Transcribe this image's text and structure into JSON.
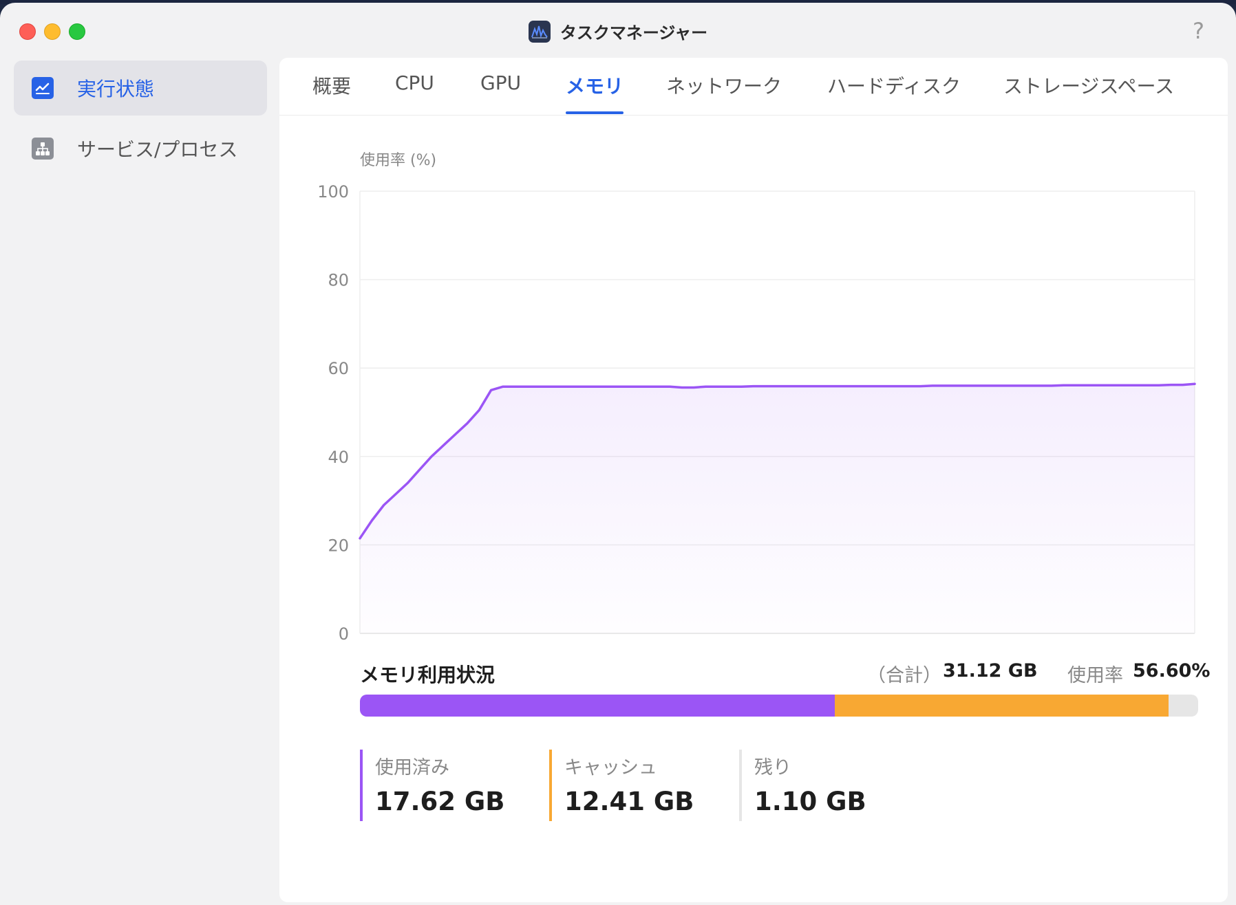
{
  "window": {
    "title": "タスクマネージャー",
    "help": "?"
  },
  "sidebar": {
    "items": [
      {
        "label": "実行状態",
        "icon": "chart-line-icon",
        "active": true
      },
      {
        "label": "サービス/プロセス",
        "icon": "hierarchy-icon",
        "active": false
      }
    ]
  },
  "tabs": [
    {
      "label": "概要",
      "active": false
    },
    {
      "label": "CPU",
      "active": false
    },
    {
      "label": "GPU",
      "active": false
    },
    {
      "label": "メモリ",
      "active": true
    },
    {
      "label": "ネットワーク",
      "active": false
    },
    {
      "label": "ハードディスク",
      "active": false
    },
    {
      "label": "ストレージスペース",
      "active": false
    }
  ],
  "chart_data": {
    "type": "area",
    "title": "",
    "ylabel": "使用率 (%)",
    "xlabel": "",
    "ylim": [
      0,
      100
    ],
    "yticks": [
      100,
      80,
      60,
      40,
      20,
      0
    ],
    "grid": true,
    "color": "#9b55f5",
    "series": [
      {
        "values": [
          21.5,
          25.5,
          29,
          31.5,
          34,
          37,
          40,
          42.5,
          45,
          47.5,
          50.5,
          55,
          55.8,
          55.8,
          55.8,
          55.8,
          55.8,
          55.8,
          55.8,
          55.8,
          55.8,
          55.8,
          55.8,
          55.8,
          55.8,
          55.8,
          55.8,
          55.6,
          55.6,
          55.8,
          55.8,
          55.8,
          55.8,
          55.9,
          55.9,
          55.9,
          55.9,
          55.9,
          55.9,
          55.9,
          55.9,
          55.9,
          55.9,
          55.9,
          55.9,
          55.9,
          55.9,
          55.9,
          56,
          56,
          56,
          56,
          56,
          56,
          56,
          56,
          56,
          56,
          56,
          56.1,
          56.1,
          56.1,
          56.1,
          56.1,
          56.1,
          56.1,
          56.1,
          56.1,
          56.2,
          56.2,
          56.4
        ]
      }
    ]
  },
  "memory": {
    "title": "メモリ利用状況",
    "total_label": "（合計）",
    "total_value": "31.12 GB",
    "rate_label": "使用率",
    "rate_value": "56.60%",
    "bar": {
      "used_fraction": 0.5662,
      "cache_fraction": 0.3988,
      "used_color": "#9b55f5",
      "cache_color": "#f8a833",
      "free_color": "#e6e6e6"
    },
    "stats": [
      {
        "label": "使用済み",
        "value": "17.62 GB",
        "color": "#9b55f5"
      },
      {
        "label": "キャッシュ",
        "value": "12.41 GB",
        "color": "#f8a833"
      },
      {
        "label": "残り",
        "value": "1.10 GB",
        "color": "#e6e6e6"
      }
    ]
  }
}
